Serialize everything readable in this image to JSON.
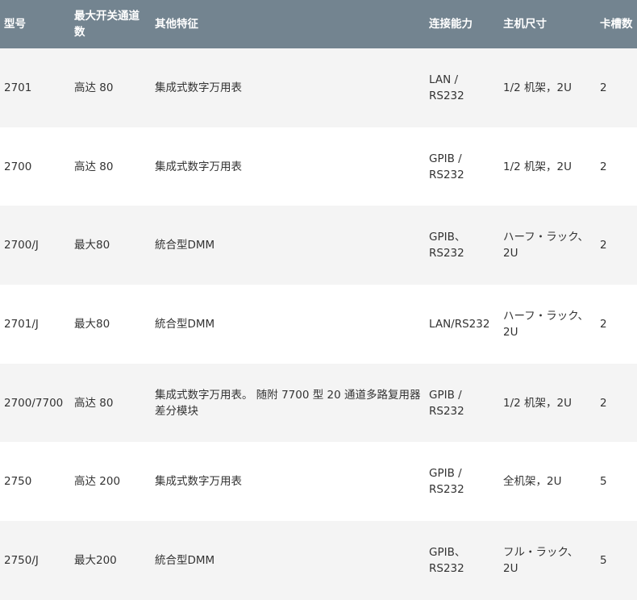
{
  "table": {
    "headers": [
      "型号",
      "最大开关通道数",
      "其他特征",
      "连接能力",
      "主机尺寸",
      "卡槽数"
    ],
    "rows": [
      [
        "2701",
        "高达 80",
        "集成式数字万用表",
        "LAN / RS232",
        "1/2 机架，2U",
        "2"
      ],
      [
        "2700",
        "高达 80",
        "集成式数字万用表",
        "GPIB / RS232",
        "1/2 机架，2U",
        "2"
      ],
      [
        "2700/J",
        "最大80",
        "統合型DMM",
        "GPIB、 RS232",
        "ハーフ・ラック、2U",
        "2"
      ],
      [
        "2701/J",
        "最大80",
        "統合型DMM",
        "LAN/RS232",
        "ハーフ・ラック、2U",
        "2"
      ],
      [
        "2700/7700",
        "高达 80",
        "集成式数字万用表。 随附 7700 型 20 通道多路复用器差分模块",
        "GPIB / RS232",
        "1/2 机架，2U",
        "2"
      ],
      [
        "2750",
        "高达 200",
        "集成式数字万用表",
        "GPIB / RS232",
        "全机架，2U",
        "5"
      ],
      [
        "2750/J",
        "最大200",
        "統合型DMM",
        "GPIB、 RS232",
        "フル・ラック、2U",
        "5"
      ]
    ]
  }
}
